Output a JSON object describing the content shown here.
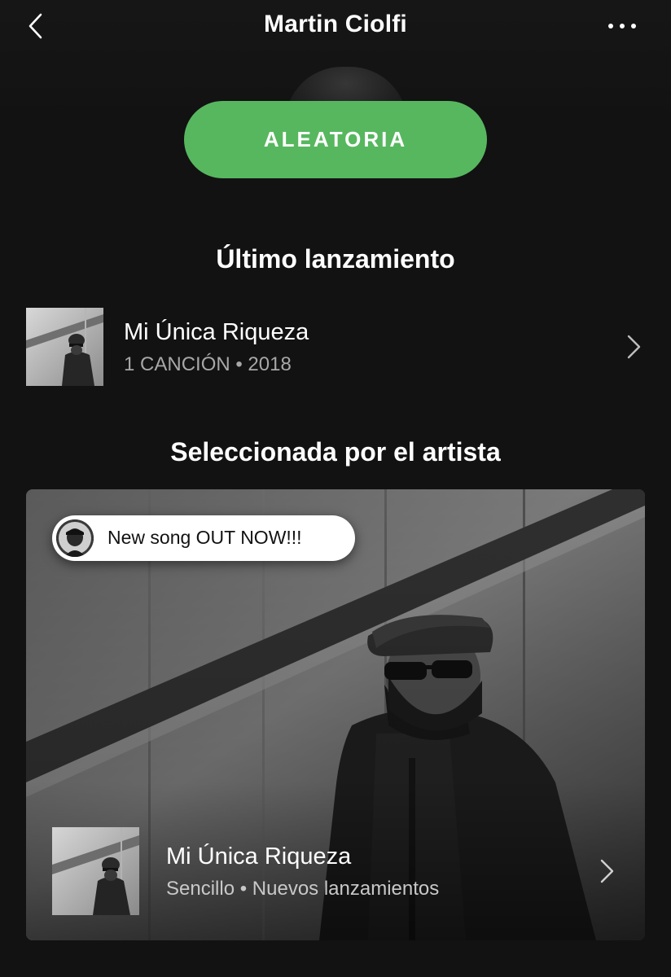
{
  "header": {
    "title": "Martin Ciolfi",
    "back_icon": "chevron-left-icon",
    "more_icon": "more-horizontal-icon"
  },
  "shuffle": {
    "label": "ALEATORIA",
    "color": "#57b75f"
  },
  "latest_release": {
    "section_title": "Último lanzamiento",
    "title": "Mi Única Riqueza",
    "meta": "1 CANCIÓN • 2018"
  },
  "artist_pick": {
    "section_title": "Seleccionada por el artista",
    "comment": "New song OUT NOW!!!",
    "title": "Mi Única Riqueza",
    "meta": "Sencillo • Nuevos lanzamientos"
  },
  "colors": {
    "background": "#121212",
    "accent": "#57b75f",
    "secondary_text": "#a7a7a7"
  }
}
